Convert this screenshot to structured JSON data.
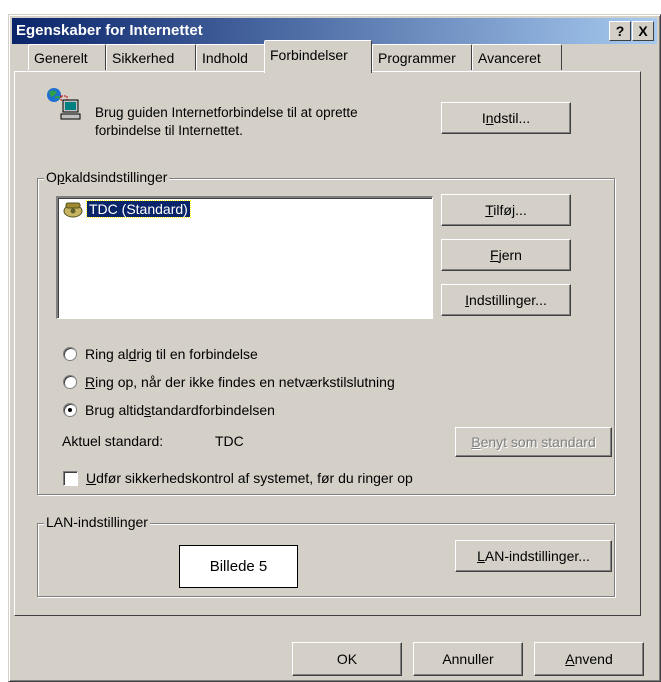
{
  "window": {
    "title": "Egenskaber for Internettet",
    "help_label": "?",
    "close_label": "X"
  },
  "tabs": [
    {
      "label": "Generelt",
      "active": false
    },
    {
      "label": "Sikkerhed",
      "active": false
    },
    {
      "label": "Indhold",
      "active": false
    },
    {
      "label": "Forbindelser",
      "active": true
    },
    {
      "label": "Programmer",
      "active": false
    },
    {
      "label": "Avanceret",
      "active": false
    }
  ],
  "wizard": {
    "text_line1": "Brug guiden Internetforbindelse til at oprette",
    "text_line2": "forbindelse til Internettet.",
    "button_pre": "I",
    "button_key": "n",
    "button_post": "dstil..."
  },
  "dialup": {
    "group_pre": "O",
    "group_key": "p",
    "group_post": "kaldsindstillinger",
    "connection": "TDC (Standard)",
    "add_key": "T",
    "add_post": "ilføj...",
    "remove_key": "F",
    "remove_post": "jern",
    "settings_key": "I",
    "settings_post": "ndstillinger...",
    "radio1_pre": "Ring al",
    "radio1_key": "d",
    "radio1_post": "rig til en forbindelse",
    "radio2_key": "R",
    "radio2_post": "ing op, når der ikke findes en netværkstilslutning",
    "radio3_pre": "Brug altid ",
    "radio3_key": "s",
    "radio3_post": "tandardforbindelsen",
    "current_label": "Aktuel standard:",
    "current_value": "TDC",
    "set_default_key": "B",
    "set_default_post": "enyt som standard",
    "checkbox_key": "U",
    "checkbox_post": "dfør sikkerhedskontrol af systemet, før du ringer op"
  },
  "lan": {
    "group_label": "LAN-indstillinger",
    "button_key": "L",
    "button_post": "AN-indstillinger..."
  },
  "caption": "Billede 5",
  "footer": {
    "ok": "OK",
    "cancel": "Annuller",
    "apply_key": "A",
    "apply_post": "nvend"
  }
}
